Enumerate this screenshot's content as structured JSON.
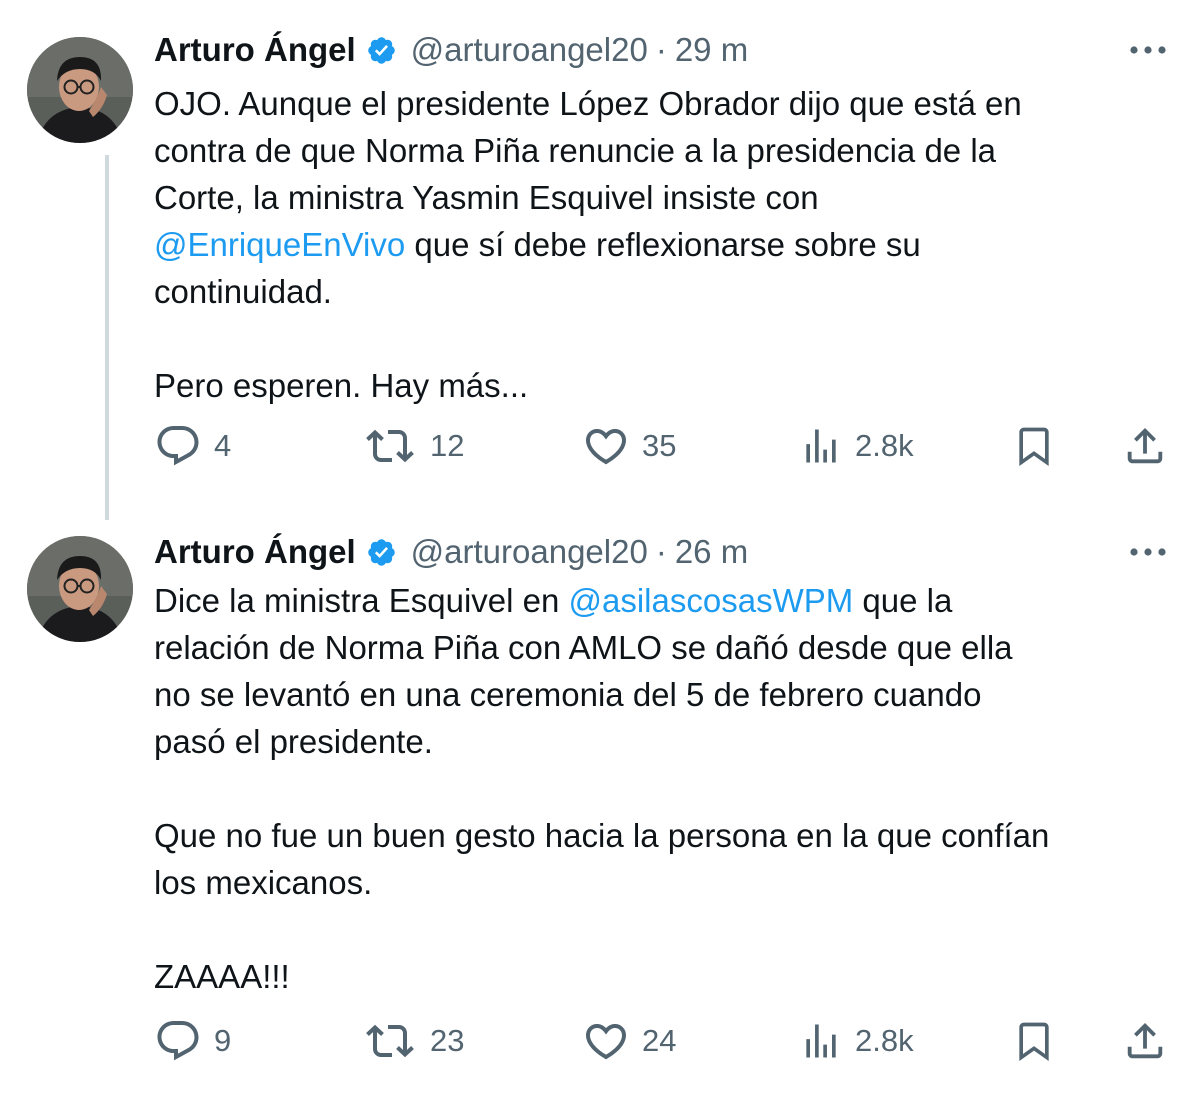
{
  "tweets": [
    {
      "author": "Arturo Ángel",
      "handle": "@arturoangel20",
      "separator": "·",
      "time": "29 m",
      "paragraphs": [
        [
          {
            "text": "OJO. Aunque el presidente López Obrador dijo que está en"
          },
          {
            "br": true
          },
          {
            "text": "contra de que Norma Piña renuncie a la presidencia de la"
          },
          {
            "br": true
          },
          {
            "text": "Corte, la ministra Yasmin Esquivel insiste con"
          },
          {
            "br": true
          },
          {
            "text": "@EnriqueEnVivo",
            "mention": true
          },
          {
            "text": " que sí debe reflexionarse sobre su"
          },
          {
            "br": true
          },
          {
            "text": "continuidad."
          }
        ],
        [
          {
            "text": "Pero esperen. Hay más..."
          }
        ]
      ],
      "stats": {
        "replies": "4",
        "retweets": "12",
        "likes": "35",
        "views": "2.8k"
      }
    },
    {
      "author": "Arturo Ángel",
      "handle": "@arturoangel20",
      "separator": "·",
      "time": "26 m",
      "paragraphs": [
        [
          {
            "text": "Dice la ministra Esquivel en "
          },
          {
            "text": "@asilascosasWPM",
            "mention": true
          },
          {
            "text": " que la"
          },
          {
            "br": true
          },
          {
            "text": "relación de Norma Piña con AMLO se dañó desde que ella"
          },
          {
            "br": true
          },
          {
            "text": "no se levantó en una ceremonia del 5 de febrero cuando"
          },
          {
            "br": true
          },
          {
            "text": "pasó el presidente."
          }
        ],
        [
          {
            "text": "Que no fue un buen gesto hacia la persona en la que confían"
          },
          {
            "br": true
          },
          {
            "text": "los mexicanos."
          }
        ],
        [
          {
            "text": "ZAAAA!!!"
          }
        ]
      ],
      "stats": {
        "replies": "9",
        "retweets": "23",
        "likes": "24",
        "views": "2.8k"
      }
    }
  ],
  "icons": {
    "verified": "verified-badge-icon",
    "more": "more-options-icon",
    "reply": "reply-icon",
    "retweet": "retweet-icon",
    "like": "like-icon",
    "views": "views-icon",
    "bookmark": "bookmark-icon",
    "share": "share-icon"
  },
  "colors": {
    "text": "#0f1419",
    "secondary": "#536471",
    "mention": "#1d9bf0",
    "verified": "#1d9bf0",
    "thread_line": "#cfd9de"
  }
}
